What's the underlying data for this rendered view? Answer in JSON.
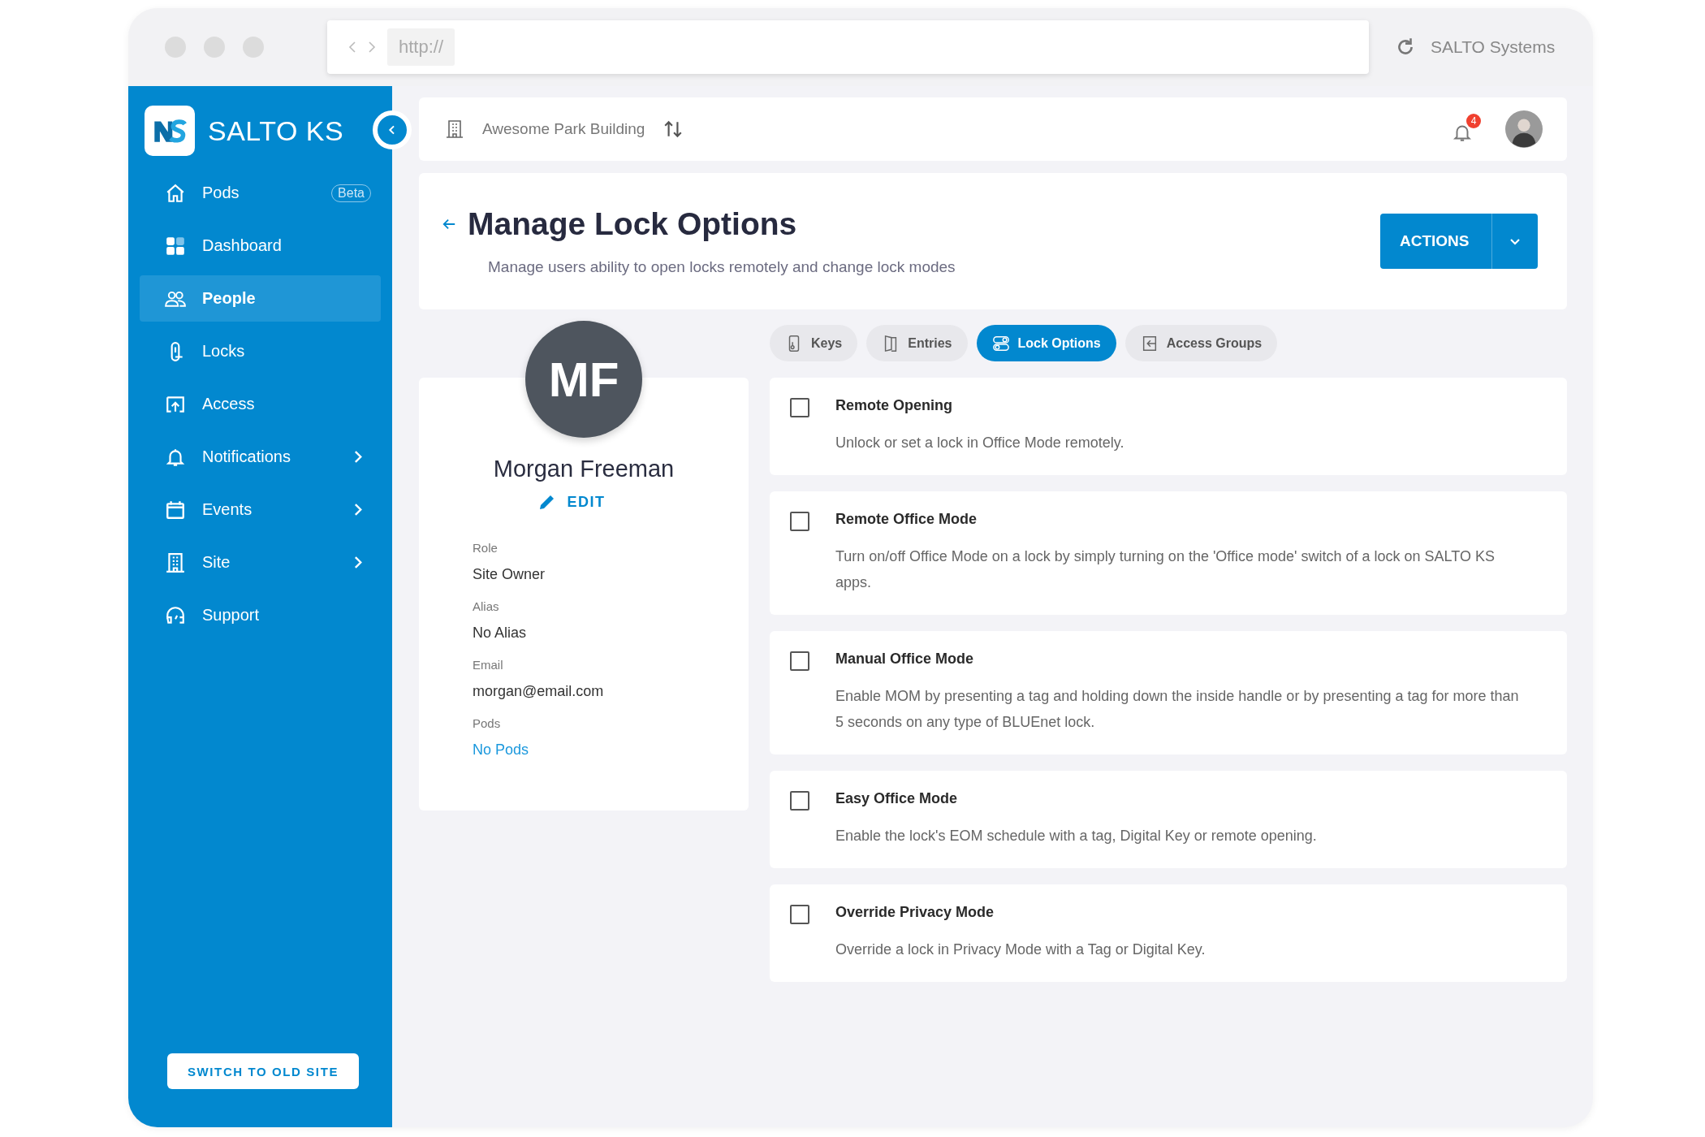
{
  "browser": {
    "url": "http://",
    "site": "SALTO Systems"
  },
  "sidebar": {
    "brand": "SALTO KS",
    "items": [
      {
        "label": "Pods",
        "kind": "home",
        "badge": "Beta",
        "selected": false,
        "submenu": false
      },
      {
        "label": "Dashboard",
        "kind": "grid",
        "selected": false,
        "submenu": false
      },
      {
        "label": "People",
        "kind": "people",
        "selected": true,
        "submenu": false
      },
      {
        "label": "Locks",
        "kind": "lock",
        "selected": false,
        "submenu": false
      },
      {
        "label": "Access",
        "kind": "access",
        "selected": false,
        "submenu": false
      },
      {
        "label": "Notifications",
        "kind": "bell",
        "selected": false,
        "submenu": true
      },
      {
        "label": "Events",
        "kind": "calendar",
        "selected": false,
        "submenu": true
      },
      {
        "label": "Site",
        "kind": "building",
        "selected": false,
        "submenu": true
      },
      {
        "label": "Support",
        "kind": "headset",
        "selected": false,
        "submenu": false
      }
    ],
    "footer_button": "SWITCH TO OLD SITE"
  },
  "topbar": {
    "building": "Awesome Park Building",
    "notification_count": "4"
  },
  "header": {
    "title": "Manage Lock Options",
    "subtitle": "Manage users ability to open locks remotely and change lock modes",
    "actions": "ACTIONS"
  },
  "profile": {
    "initials": "MF",
    "name": "Morgan Freeman",
    "edit": "EDIT",
    "fields": [
      {
        "label": "Role",
        "value": "Site Owner",
        "kind": "text"
      },
      {
        "label": "Alias",
        "value": "No Alias",
        "kind": "text"
      },
      {
        "label": "Email",
        "value": "morgan@email.com",
        "kind": "text"
      },
      {
        "label": "Pods",
        "value": "No Pods",
        "kind": "link"
      }
    ]
  },
  "tabs": [
    {
      "label": "Keys",
      "kind": "key",
      "selected": false
    },
    {
      "label": "Entries",
      "kind": "door",
      "selected": false
    },
    {
      "label": "Lock Options",
      "kind": "toggles",
      "selected": true
    },
    {
      "label": "Access Groups",
      "kind": "enter",
      "selected": false
    }
  ],
  "options": [
    {
      "title": "Remote Opening",
      "description": "Unlock or set a lock in Office Mode remotely.",
      "checked": false
    },
    {
      "title": "Remote Office Mode",
      "description": "Turn on/off Office Mode on a lock by simply turning on the 'Office mode' switch of a lock on SALTO KS apps.",
      "checked": false
    },
    {
      "title": "Manual Office Mode",
      "description": "Enable MOM by presenting a tag and holding down the inside handle or by presenting a tag for more than 5 seconds on any type of BLUEnet lock.",
      "checked": false
    },
    {
      "title": "Easy Office Mode",
      "description": "Enable the lock's EOM schedule with a tag, Digital Key or remote opening.",
      "checked": false
    },
    {
      "title": "Override Privacy Mode",
      "description": "Override a lock in Privacy Mode with a Tag or Digital Key.",
      "checked": false
    }
  ]
}
